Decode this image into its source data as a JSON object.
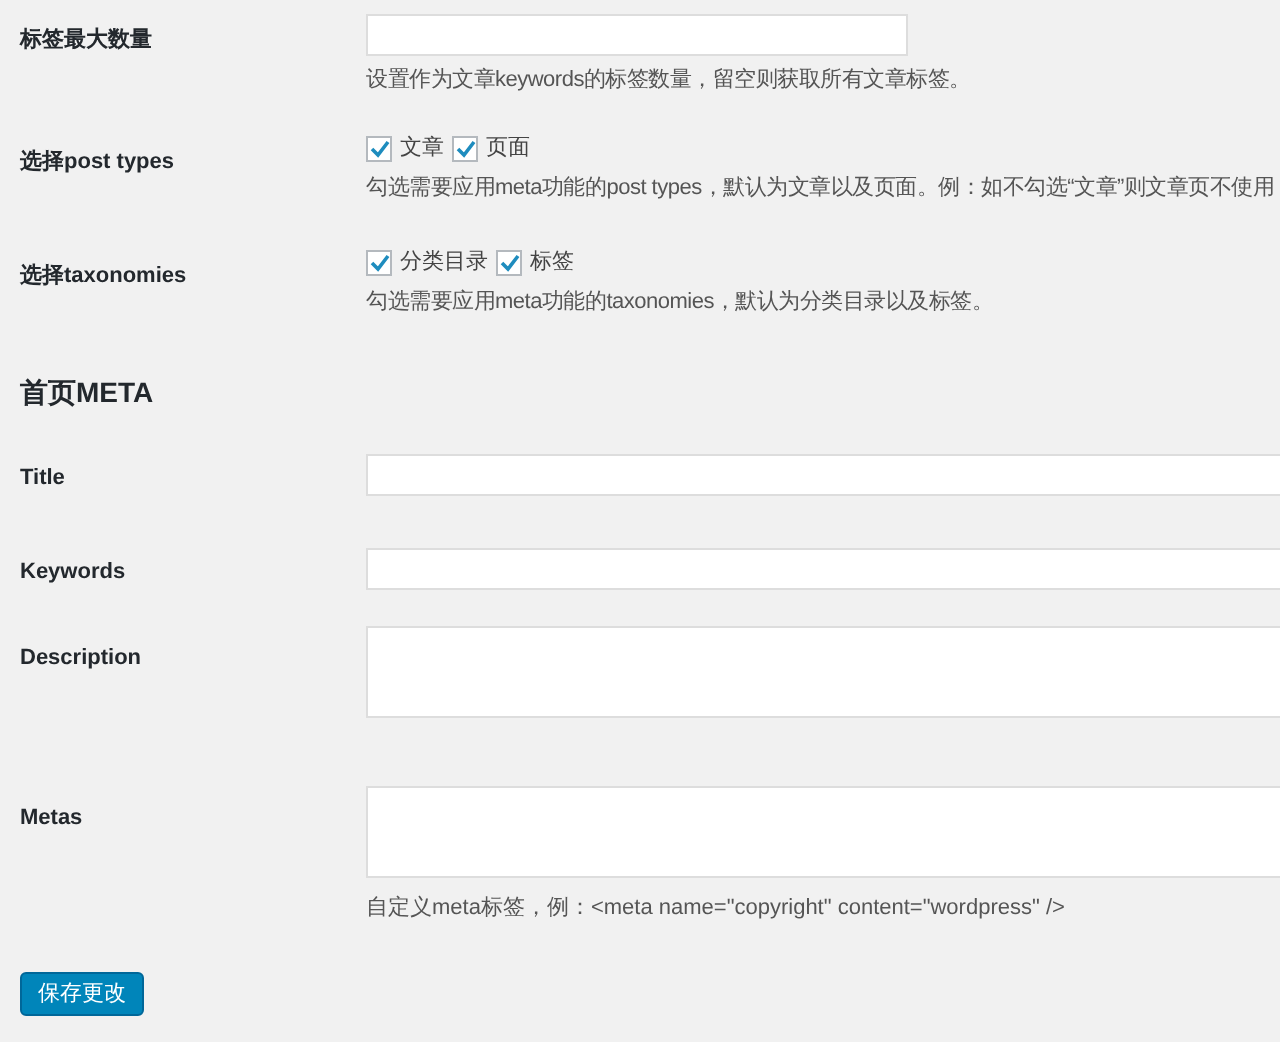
{
  "rows": [
    {
      "kind": "short-input",
      "label": "标签最大数量",
      "description": "设置作为文章keywords的标签数量，留空则获取所有文章标签。"
    },
    {
      "kind": "checkboxes",
      "label": "选择post types",
      "options": [
        {
          "label": "文章",
          "checked": true
        },
        {
          "label": "页面",
          "checked": true
        }
      ],
      "description": "勾选需要应用meta功能的post types，默认为文章以及页面。例：如不勾选“文章”则文章页不使用"
    },
    {
      "kind": "checkboxes",
      "label": "选择taxonomies",
      "options": [
        {
          "label": "分类目录",
          "checked": true
        },
        {
          "label": "标签",
          "checked": true
        }
      ],
      "description": "勾选需要应用meta功能的taxonomies，默认为分类目录以及标签。"
    },
    {
      "kind": "heading",
      "label": "首页META"
    },
    {
      "kind": "input",
      "label": "Title"
    },
    {
      "kind": "input",
      "label": "Keywords"
    },
    {
      "kind": "textarea",
      "label": "Description"
    },
    {
      "kind": "textarea",
      "label": "Metas",
      "description": "自定义meta标签，例：<meta name=\"copyright\" content=\"wordpress\" />"
    }
  ],
  "save_button": "保存更改"
}
